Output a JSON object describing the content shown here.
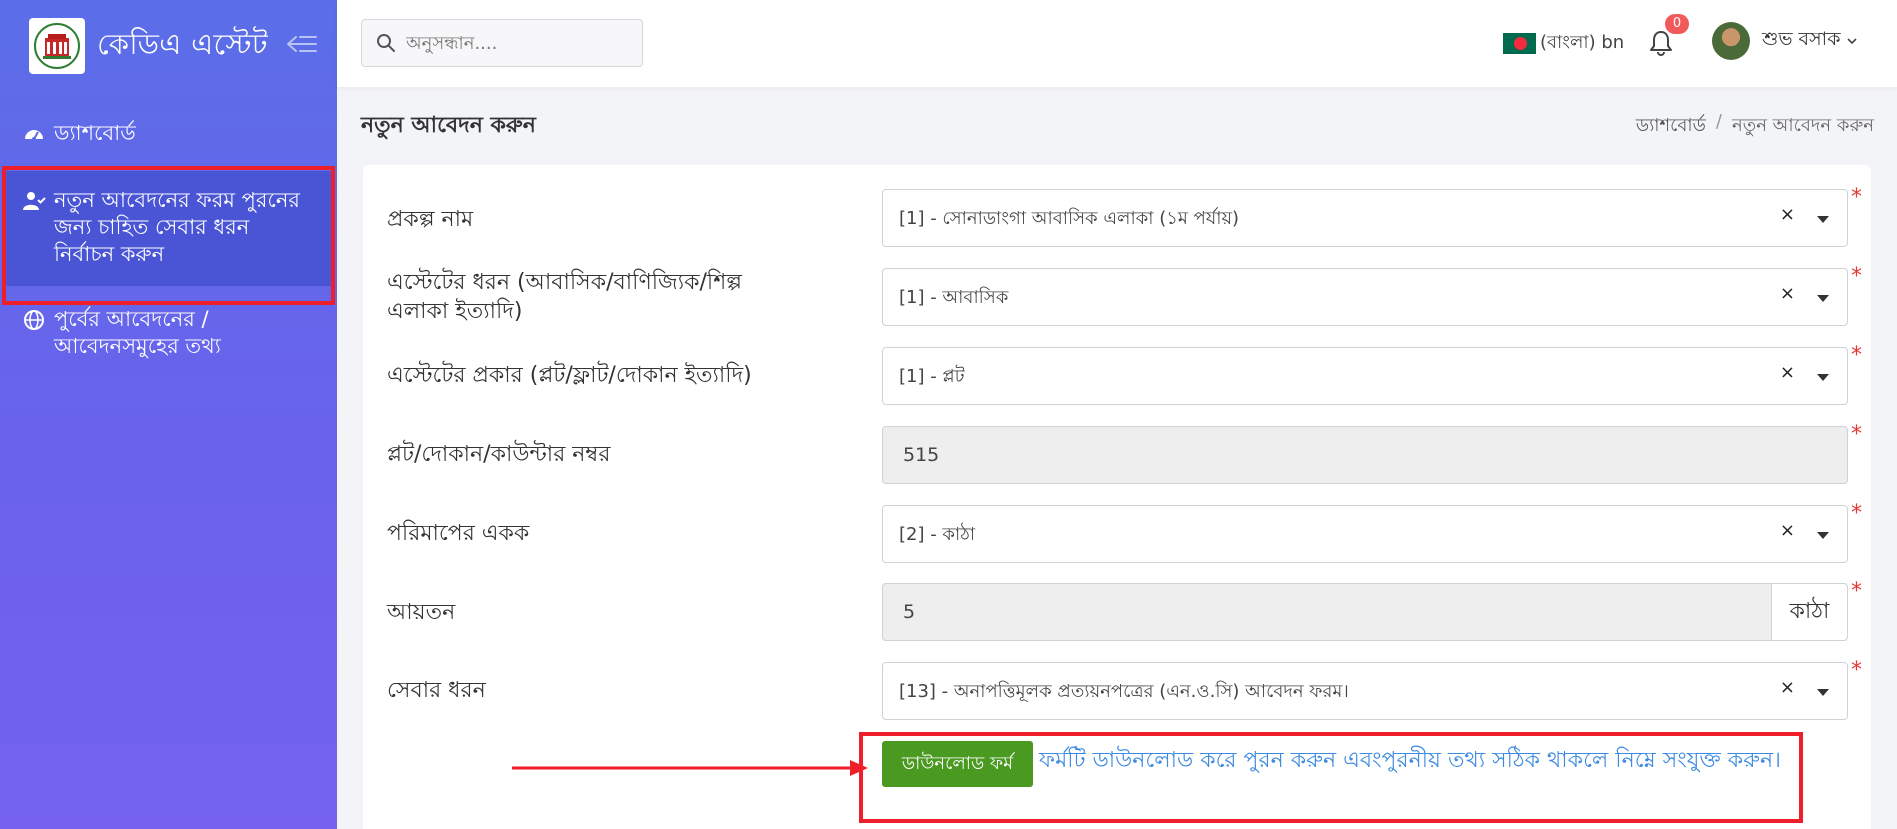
{
  "brand": {
    "name": "কেডিএ এস্টেট",
    "logo_icon": "kda-emblem-icon"
  },
  "sidebar": {
    "items": [
      {
        "label": "ড্যাশবোর্ড",
        "icon": "dashboard-icon",
        "active": false
      },
      {
        "label": "নতুন আবেদনের ফরম পুরনের জন্য চাহিত সেবার ধরন নির্বাচন করুন",
        "icon": "user-check-icon",
        "active": true
      },
      {
        "label": "পুর্বের আবেদনের / আবেদনসমুহের তথ্য",
        "icon": "globe-icon",
        "active": false
      }
    ]
  },
  "topbar": {
    "search_placeholder": "অনুসন্ধান....",
    "language": "(বাংলা) bn",
    "notification_count": "0",
    "user_name": "শুভ বসাক"
  },
  "page": {
    "title": "নতুন আবেদন করুন",
    "breadcrumb": [
      "ড্যাশবোর্ড",
      "/",
      "নতুন আবেদন করুন"
    ]
  },
  "form": {
    "fields": [
      {
        "label": "প্রকল্প নাম",
        "value": "[1] - সোনাডাংগা আবাসিক এলাকা (১ম পর্যায়)",
        "type": "select"
      },
      {
        "label": "এস্টেটের ধরন (আবাসিক/বাণিজ্যিক/শিল্প এলাকা ইত্যাদি)",
        "value": "[1] - আবাসিক",
        "type": "select"
      },
      {
        "label": "এস্টেটের প্রকার (প্লট/ফ্লাট/দোকান ইত্যাদি)",
        "value": "[1] - প্লট",
        "type": "select"
      },
      {
        "label": "প্লট/দোকান/কাউন্টার নম্বর",
        "value": "515",
        "type": "readonly"
      },
      {
        "label": "পরিমাপের একক",
        "value": "[2] - কাঠা",
        "type": "select"
      },
      {
        "label": "আয়তন",
        "value": "5",
        "type": "readonly",
        "addon": "কাঠা"
      },
      {
        "label": "সেবার ধরন",
        "value": "[13] - অনাপত্তিমূলক প্রত্যয়নপত্রের (এন.ও.সি) আবেদন ফরম।",
        "type": "select"
      }
    ],
    "clear_symbol": "×",
    "required_mark": "*",
    "download_button": "ডাউনলোড ফর্ম",
    "download_note": "ফর্মটি ডাউনলোড করে পুরন করুন এবংপুরনীয় তথ্য সঠিক থাকলে নিম্নে সংযুক্ত করুন।"
  },
  "colors": {
    "sidebar_top": "#5b6ee8",
    "sidebar_active": "#4a55d6",
    "highlight_red": "#ee1f2b",
    "download_green": "#4a9a22",
    "link_blue": "#3c8ae2"
  }
}
